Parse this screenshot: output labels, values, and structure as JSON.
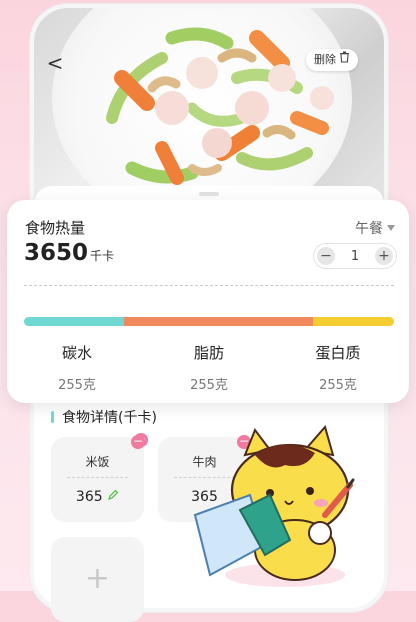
{
  "header": {
    "back_label": "<",
    "delete_label": "删除"
  },
  "calorie_card": {
    "title": "食物热量",
    "meal": "午餐",
    "kcal_value": "3650",
    "kcal_unit": "千卡",
    "quantity": "1",
    "minus": "−",
    "plus": "+",
    "macro_colors": {
      "carbs": "#6fd8d3",
      "fat": "#f08a5d",
      "protein": "#f6cd2f"
    },
    "macro_shares": {
      "carbs": 0.27,
      "fat": 0.51,
      "protein": 0.22
    },
    "macros": [
      {
        "name": "碳水",
        "value": "255克"
      },
      {
        "name": "脂肪",
        "value": "255克"
      },
      {
        "name": "蛋白质",
        "value": "255克"
      }
    ]
  },
  "details": {
    "title": "食物详情(千卡)",
    "items": [
      {
        "name": "米饭",
        "value": "365"
      },
      {
        "name": "牛肉",
        "value": "365"
      }
    ],
    "add_label": "+"
  }
}
